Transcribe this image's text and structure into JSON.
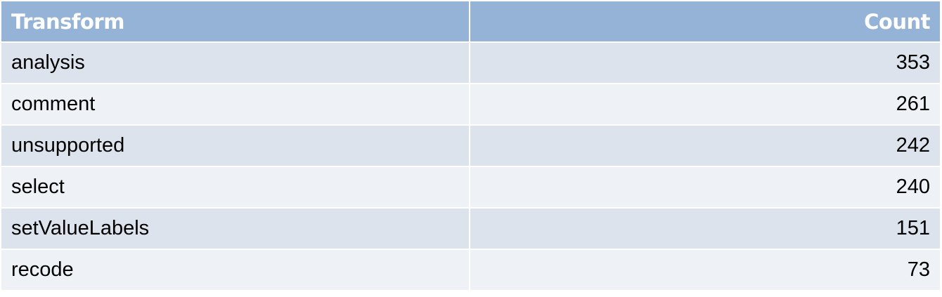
{
  "table": {
    "headers": {
      "transform": "Transform",
      "count": "Count"
    },
    "rows": [
      {
        "transform": "analysis",
        "count": "353"
      },
      {
        "transform": "comment",
        "count": "261"
      },
      {
        "transform": "unsupported",
        "count": "242"
      },
      {
        "transform": "select",
        "count": "240"
      },
      {
        "transform": "setValueLabels",
        "count": "151"
      },
      {
        "transform": "recode",
        "count": "73"
      }
    ]
  },
  "colors": {
    "header_bg": "#95b3d7",
    "row_odd_bg": "#dce3ed",
    "row_even_bg": "#eef2f7"
  }
}
